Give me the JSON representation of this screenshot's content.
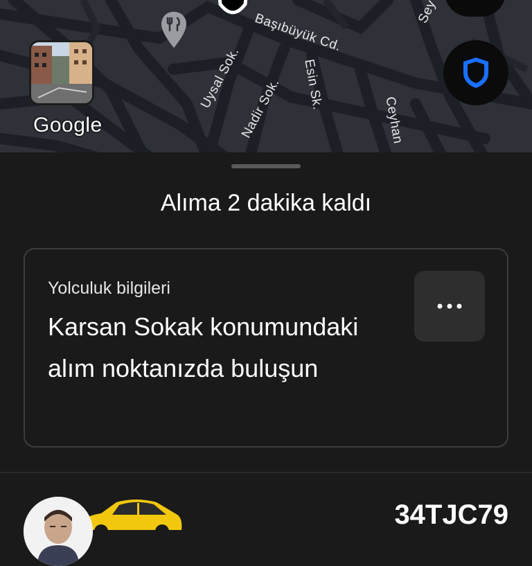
{
  "map": {
    "streets": {
      "basibuyuk": "Başıbüyük Cd.",
      "uysal": "Uysal Sok.",
      "nadir": "Nadir Sok.",
      "esin": "Esin Sk.",
      "ceyhan": "Ceyhan",
      "sey": "Sey"
    },
    "attribution": "Google",
    "icons": {
      "poi": "restaurant-icon",
      "safety": "shield-icon"
    },
    "colors": {
      "background": "#2e3138",
      "roads": "#1c1f26",
      "shield": "#1a6fff"
    }
  },
  "sheet": {
    "status_title": "Alıma 2 dakika kaldı",
    "card": {
      "label": "Yolculuk bilgileri",
      "main_text": "Karsan Sokak konumundaki alım noktanızda buluşun",
      "more_icon": "more-horizontal-icon"
    },
    "driver": {
      "plate": "34TJC79"
    }
  }
}
